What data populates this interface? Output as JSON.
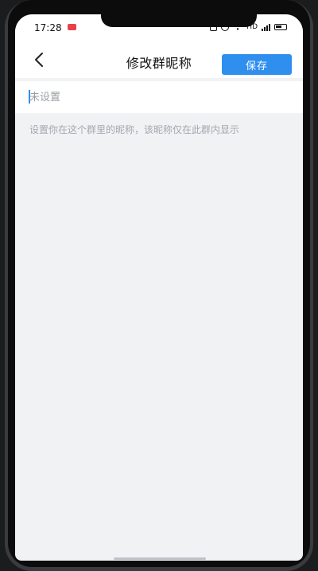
{
  "status_bar": {
    "time": "17:28",
    "network_label": "HD",
    "icons": [
      "recording-badge",
      "bell-icon",
      "alarm-icon",
      "wifi-icon",
      "signal-icon",
      "battery-icon"
    ]
  },
  "header": {
    "title": "修改群昵称",
    "save_label": "保存",
    "back_icon": "chevron-left-icon"
  },
  "nickname": {
    "placeholder": "未设置",
    "value": ""
  },
  "hint": "设置你在这个群里的昵称，该昵称仅在此群内显示",
  "colors": {
    "accent": "#2f8fef",
    "page_background": "#f0f2f4",
    "hint_text": "#a3a8ad"
  }
}
